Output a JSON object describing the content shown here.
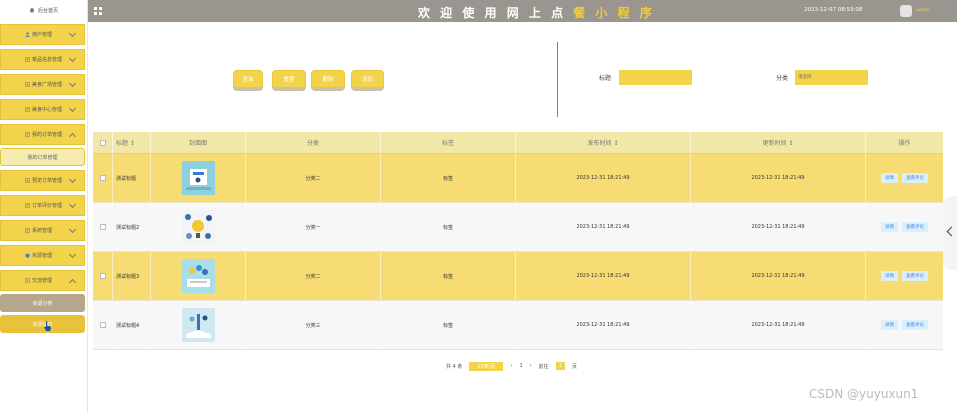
{
  "sidebar": {
    "home_label": "后台首页",
    "menu": [
      {
        "label": "用户管理",
        "icon": "user-icon",
        "expanded": false
      },
      {
        "label": "菜品信息管理",
        "icon": "list-icon",
        "expanded": false
      },
      {
        "label": "美食广场管理",
        "icon": "list-icon",
        "expanded": false
      },
      {
        "label": "美食中心管理",
        "icon": "list-icon",
        "expanded": false
      },
      {
        "label": "我的订单管理",
        "icon": "list-icon",
        "expanded": true
      },
      {
        "label": "预定订单管理",
        "icon": "list-icon",
        "expanded": false
      },
      {
        "label": "订单评价管理",
        "icon": "list-icon",
        "expanded": false
      },
      {
        "label": "系统管理",
        "icon": "list-icon",
        "expanded": false
      },
      {
        "label": "资源管理",
        "icon": "shield-icon",
        "expanded": false
      },
      {
        "label": "交流管理",
        "icon": "list-icon",
        "expanded": true
      }
    ],
    "sub_orders": "我的订单管理",
    "sub_res_a": "资源分类",
    "sub_res_b": "资源信息"
  },
  "header": {
    "title_a": "欢 迎 使 用 网 上 点 ",
    "title_b": "餐 小 程 序",
    "datetime": "2023-12-07 08:53:08",
    "user": "admin"
  },
  "toolbar": {
    "search": "查询",
    "reset": "重置",
    "delete": "删除",
    "add": "添加"
  },
  "filters": {
    "title_label": "标题",
    "title_value": "",
    "category_label": "分类",
    "category_value": "请选择"
  },
  "table": {
    "headers": [
      "标题 ↕",
      "封面图",
      "分类",
      "标签",
      "发布时间 ↕",
      "更新时间 ↕",
      "操作"
    ],
    "rows": [
      {
        "title": "测试标题",
        "category": "分类二",
        "tag": "标签",
        "published": "2023-12-31 18:21:49",
        "updated": "2023-12-31 18:21:49"
      },
      {
        "title": "测试标题2",
        "category": "分类一",
        "tag": "标签",
        "published": "2023-12-31 18:21:49",
        "updated": "2023-12-31 18:21:49"
      },
      {
        "title": "测试标题3",
        "category": "分类二",
        "tag": "标签",
        "published": "2023-12-31 18:21:49",
        "updated": "2023-12-31 18:21:49"
      },
      {
        "title": "测试标题4",
        "category": "分类三",
        "tag": "标签",
        "published": "2023-12-31 18:21:49",
        "updated": "2023-12-31 18:21:49"
      }
    ],
    "action_detail": "详情",
    "action_review": "查看评论"
  },
  "pagination": {
    "total": "共 4 条",
    "page_size": "10条/页",
    "prev": "‹",
    "page": "1",
    "next": "›",
    "goto": "前往",
    "goto_value": "1",
    "goto_suffix": "页"
  },
  "watermark": "CSDN @yuyuxun1",
  "colors": {
    "accent": "#f2d34a",
    "header": "#9b9590",
    "row_alt": "#f7dc74"
  }
}
